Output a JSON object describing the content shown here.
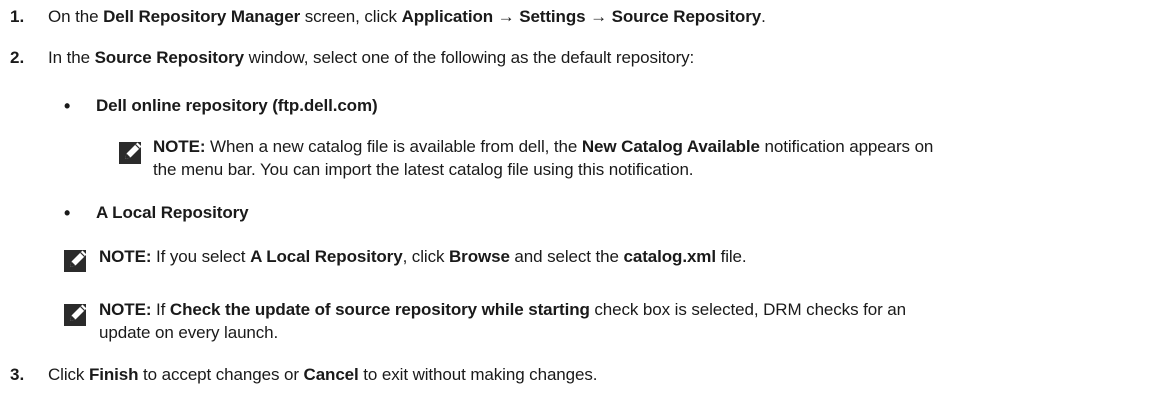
{
  "steps": [
    {
      "number": "1.",
      "parts": [
        "On the ",
        "Dell Repository Manager",
        " screen, click ",
        "Application",
        " → ",
        "Settings",
        " → ",
        "Source Repository",
        "."
      ]
    },
    {
      "number": "2.",
      "parts": [
        "In the ",
        "Source Repository",
        " window, select one of the following as the default repository:"
      ]
    },
    {
      "number": "3.",
      "parts": [
        "Click ",
        "Finish",
        " to accept changes or ",
        "Cancel",
        " to exit without making changes."
      ]
    }
  ],
  "options": [
    {
      "bullet": "•",
      "label": "Dell online repository (ftp.dell.com)"
    },
    {
      "bullet": "•",
      "label": "A Local Repository"
    }
  ],
  "notes": [
    {
      "icon": "pencil-note-icon",
      "line1": [
        "NOTE:",
        " When a new catalog file is available from dell, the ",
        "New Catalog Available",
        " notification appears on"
      ],
      "line2": "the menu bar. You can import the latest catalog file using this notification."
    },
    {
      "icon": "pencil-note-icon",
      "line1": [
        "NOTE:",
        " If you select ",
        "A Local Repository",
        ", click ",
        "Browse",
        " and select the ",
        "catalog.xml",
        " file."
      ]
    },
    {
      "icon": "pencil-note-icon",
      "line1": [
        "NOTE:",
        " If ",
        "Check the update of source repository while starting",
        " check box is selected, DRM checks for an"
      ],
      "line2": "update on every launch."
    }
  ]
}
